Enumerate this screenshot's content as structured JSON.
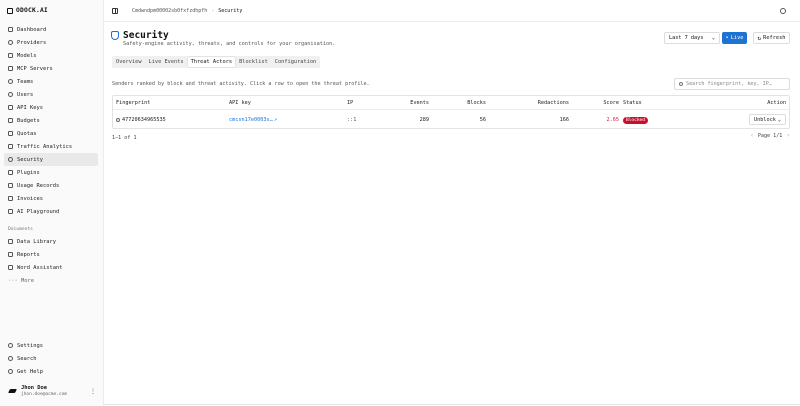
{
  "app": {
    "name": "ODOCK.AI"
  },
  "sidebar": {
    "items": [
      {
        "label": "Dashboard",
        "icon": "dashboard-icon"
      },
      {
        "label": "Providers",
        "icon": "providers-icon"
      },
      {
        "label": "Models",
        "icon": "models-icon"
      },
      {
        "label": "MCP Servers",
        "icon": "mcp-servers-icon"
      },
      {
        "label": "Teams",
        "icon": "teams-icon"
      },
      {
        "label": "Users",
        "icon": "users-icon"
      },
      {
        "label": "API Keys",
        "icon": "key-icon"
      },
      {
        "label": "Budgets",
        "icon": "budgets-icon"
      },
      {
        "label": "Quotas",
        "icon": "quotas-icon"
      },
      {
        "label": "Traffic Analytics",
        "icon": "analytics-icon"
      },
      {
        "label": "Security",
        "icon": "shield-icon",
        "active": true
      },
      {
        "label": "Plugins",
        "icon": "plugins-icon"
      },
      {
        "label": "Usage Records",
        "icon": "records-icon"
      },
      {
        "label": "Invoices",
        "icon": "invoices-icon"
      },
      {
        "label": "AI Playground",
        "icon": "playground-icon"
      }
    ],
    "documents_label": "Documents",
    "documents": [
      {
        "label": "Data Library",
        "icon": "library-icon"
      },
      {
        "label": "Reports",
        "icon": "reports-icon"
      },
      {
        "label": "Word Assistant",
        "icon": "word-icon"
      }
    ],
    "more_label": "··· More",
    "bottom": [
      {
        "label": "Settings",
        "icon": "settings-icon"
      },
      {
        "label": "Search",
        "icon": "search-icon"
      },
      {
        "label": "Get Help",
        "icon": "help-icon"
      }
    ],
    "user": {
      "name": "Jhon Doe",
      "email": "jhon.doe@acme.com"
    }
  },
  "topbar": {
    "breadcrumb_root": "Cmdwndpm00002sb0fxfzdhpfh",
    "breadcrumb_sep": "›",
    "breadcrumb_current": "Security"
  },
  "page": {
    "title": "Security",
    "subtitle": "Safety-engine activity, threats, and controls for your organisation.",
    "range": "Last 7 days",
    "live_label": "Live",
    "refresh_label": "Refresh",
    "tabs": [
      {
        "label": "Overview"
      },
      {
        "label": "Live Events"
      },
      {
        "label": "Threat Actors",
        "active": true
      },
      {
        "label": "Blocklist"
      },
      {
        "label": "Configuration"
      }
    ],
    "description": "Senders ranked by block and threat activity. Click a row to open the threat profile.",
    "search_placeholder": "Search fingerprint, key, IP…",
    "table": {
      "columns": {
        "fingerprint": "Fingerprint",
        "api_key": "API key",
        "ip": "IP",
        "events": "Events",
        "blocks": "Blocks",
        "redactions": "Redactions",
        "score": "Score",
        "status": "Status",
        "action": "Action"
      },
      "rows": [
        {
          "fingerprint": "47720634965535",
          "api_key": "cmcsn17e0003s…",
          "api_key_icon": "↗",
          "ip": "::1",
          "events": "289",
          "blocks": "56",
          "redactions": "166",
          "score": "2.65",
          "status": "Blocked",
          "action": "Unblock"
        }
      ]
    },
    "row_count": "1–1 of 1",
    "pager_label": "Page 1/1",
    "prev_arrow": "‹",
    "next_arrow": "›"
  },
  "colors": {
    "accent": "#1d72d2",
    "danger": "#c8102e",
    "score": "#d61b45"
  }
}
